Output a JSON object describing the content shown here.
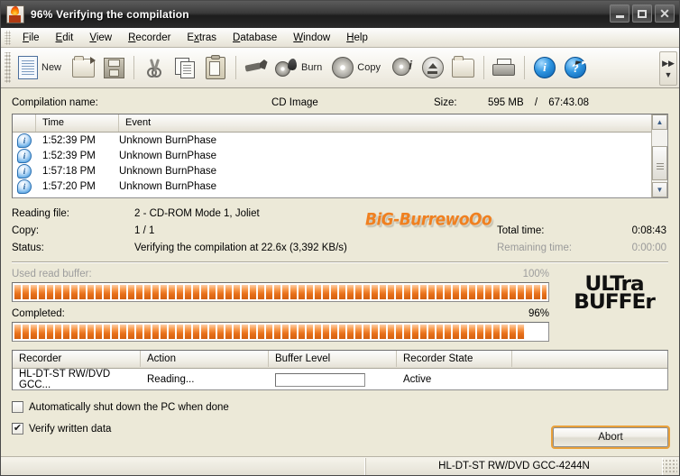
{
  "window": {
    "title": "96% Verifying the compilation",
    "icon": "nero-flame-icon",
    "minimize_label": "–",
    "maximize_label": "□",
    "close_label": "✕"
  },
  "menu": {
    "items": [
      {
        "label": "File",
        "accel": "F"
      },
      {
        "label": "Edit",
        "accel": "E"
      },
      {
        "label": "View",
        "accel": "V"
      },
      {
        "label": "Recorder",
        "accel": "R"
      },
      {
        "label": "Extras",
        "accel": "x"
      },
      {
        "label": "Database",
        "accel": "D"
      },
      {
        "label": "Window",
        "accel": "W"
      },
      {
        "label": "Help",
        "accel": "H"
      }
    ]
  },
  "toolbar": {
    "new_label": "New",
    "burn_label": "Burn",
    "copy_label": "Copy",
    "overflow_label": "»",
    "buttons": [
      {
        "name": "new-document",
        "icon": "document-icon"
      },
      {
        "name": "open",
        "icon": "folder-open-icon"
      },
      {
        "name": "save",
        "icon": "floppy-save-icon"
      },
      {
        "name": "cut",
        "icon": "scissors-icon"
      },
      {
        "name": "copy-clipboard",
        "icon": "copy-pages-icon"
      },
      {
        "name": "paste",
        "icon": "clipboard-paste-icon"
      },
      {
        "name": "burn-wizard",
        "icon": "burn-wizard-icon"
      },
      {
        "name": "burn",
        "icon": "cd-flame-icon"
      },
      {
        "name": "copy-disc",
        "icon": "cd-disc-icon"
      },
      {
        "name": "disc-info",
        "icon": "cd-info-icon"
      },
      {
        "name": "eject",
        "icon": "eject-icon"
      },
      {
        "name": "open-folder",
        "icon": "folder-icon"
      },
      {
        "name": "print",
        "icon": "printer-icon"
      },
      {
        "name": "info",
        "icon": "info-circle-icon"
      },
      {
        "name": "help",
        "icon": "help-circle-icon"
      }
    ]
  },
  "compilation": {
    "name_label": "Compilation name:",
    "name_value": "CD Image",
    "size_label": "Size:",
    "size_value": "595 MB",
    "size_separator": "/",
    "size_time": "67:43.08"
  },
  "event_list": {
    "columns": [
      "",
      "Time",
      "Event"
    ],
    "rows": [
      {
        "icon": "info-bubble-icon",
        "time": "1:52:39 PM",
        "event": "Unknown BurnPhase"
      },
      {
        "icon": "info-bubble-icon",
        "time": "1:52:39 PM",
        "event": "Unknown BurnPhase"
      },
      {
        "icon": "info-bubble-icon",
        "time": "1:57:18 PM",
        "event": "Unknown BurnPhase"
      },
      {
        "icon": "info-bubble-icon",
        "time": "1:57:20 PM",
        "event": "Unknown BurnPhase"
      }
    ],
    "scroll_up": "▲",
    "scroll_down": "▼"
  },
  "status": {
    "reading_file_label": "Reading file:",
    "reading_file_value": "2 - CD-ROM Mode 1, Joliet",
    "copy_label": "Copy:",
    "copy_value": "1 / 1",
    "status_label": "Status:",
    "status_value": "Verifying the compilation at 22.6x (3,392 KB/s)",
    "total_time_label": "Total time:",
    "total_time_value": "0:08:43",
    "remaining_time_label": "Remaining time:",
    "remaining_time_value": "0:00:00",
    "watermark": "BiG-BurrewoOo"
  },
  "progress": {
    "buffer_label": "Used read buffer:",
    "buffer_percent_text": "100%",
    "buffer_percent": 100,
    "completed_label": "Completed:",
    "completed_percent_text": "96%",
    "completed_percent": 96,
    "ultra_logo_line1": "ULTra",
    "ultra_logo_line2": "BUFFEr",
    "fill_color": "#e8701a"
  },
  "recorder_table": {
    "columns": [
      "Recorder",
      "Action",
      "Buffer Level",
      "Recorder State",
      ""
    ],
    "rows": [
      {
        "recorder": "HL-DT-ST RW/DVD GCC...",
        "action": "Reading...",
        "buffer_level": 0,
        "state": "Active"
      }
    ]
  },
  "options": {
    "shutdown_label": "Automatically shut down the PC when done",
    "shutdown_checked": false,
    "verify_label": "Verify written data",
    "verify_checked": true,
    "check_glyph": "✔"
  },
  "buttons": {
    "abort_label": "Abort"
  },
  "statusbar": {
    "left_text": "",
    "device_text": "HL-DT-ST RW/DVD GCC-4244N"
  }
}
